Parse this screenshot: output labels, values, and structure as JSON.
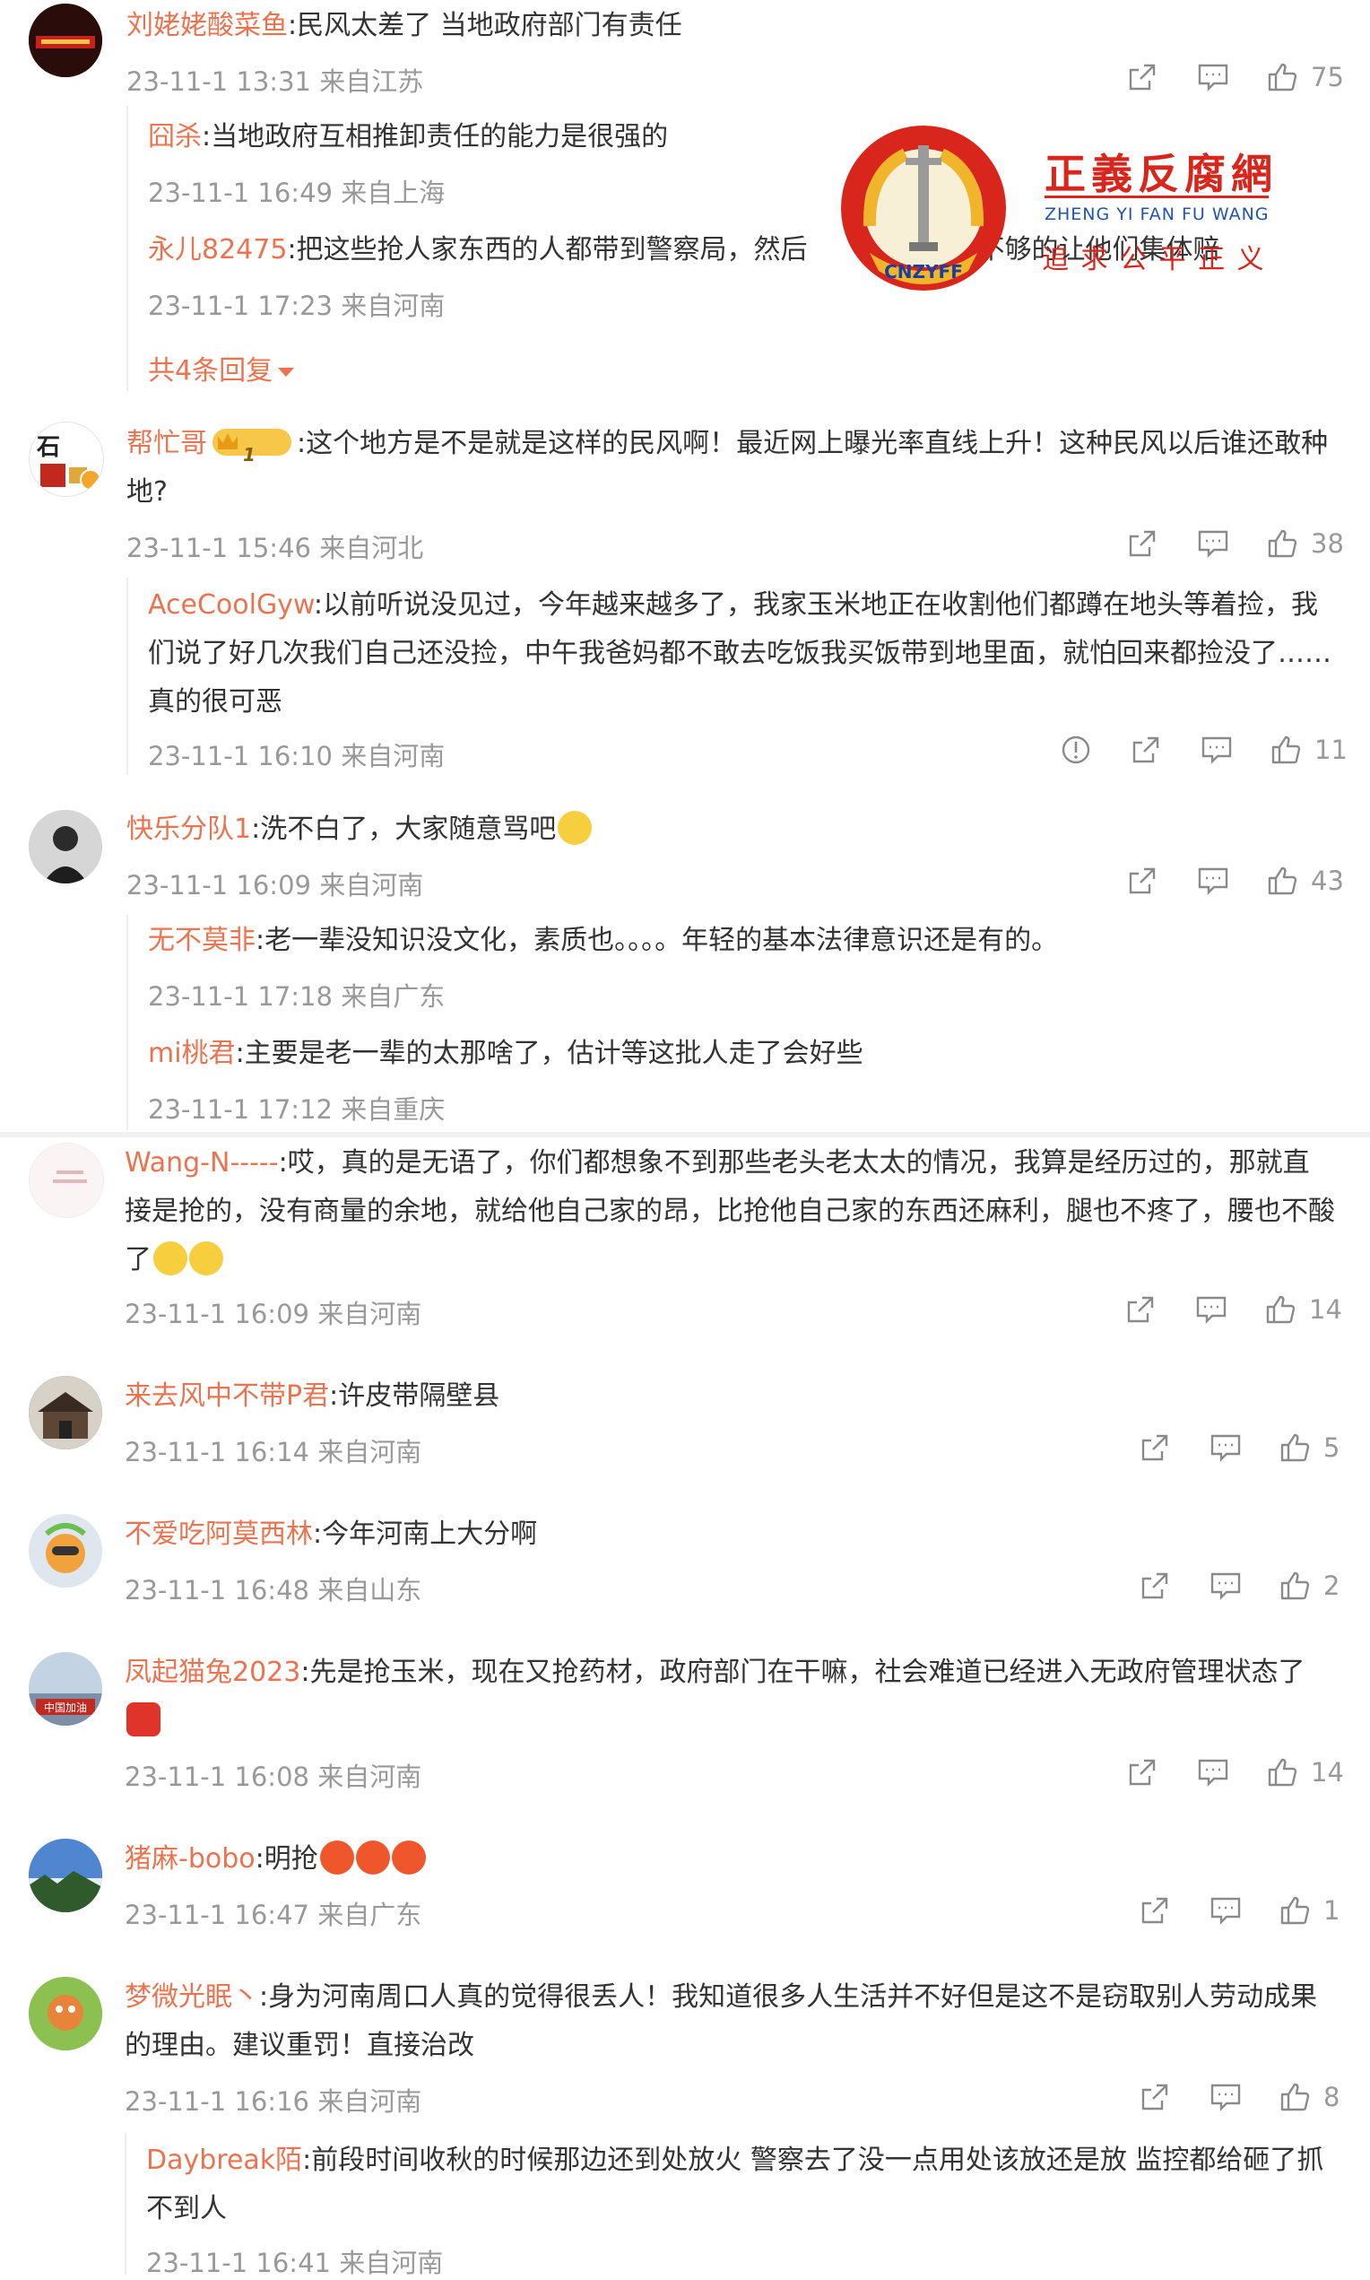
{
  "comments": [
    {
      "user": "刘姥姥酸菜鱼",
      "text": ":民风太差了 当地政府部门有责任",
      "meta": "23-11-1 13:31 来自江苏",
      "likes": "75",
      "avatar_color": "#b3201c",
      "replies": [
        {
          "user": "囧杀",
          "text": ":当地政府互相推卸责任的能力是很强的",
          "meta": "23-11-1 16:49 来自上海"
        },
        {
          "user": "永儿82475",
          "text": ":把这些抢人家东西的人都带到警察局，然后",
          "text_tail": "不够的让他们集体赔",
          "meta": "23-11-1 17:23 来自河南"
        }
      ],
      "more_replies": "共4条回复"
    },
    {
      "user": "帮忙哥",
      "badge_level": "1",
      "text": ":这个地方是不是就是这样的民风啊！最近网上曝光率直线上升！这种民风以后谁还敢种地?",
      "meta": "23-11-1 15:46 来自河北",
      "likes": "38",
      "replies": [
        {
          "user": "AceCoolGyw",
          "text": ":以前听说没见过，今年越来越多了，我家玉米地正在收割他们都蹲在地头等着捡，我们说了好几次我们自己还没捡，中午我爸妈都不敢去吃饭我买饭带到地里面，就怕回来都捡没了……真的很可恶",
          "meta": "23-11-1 16:10 来自河南",
          "likes": "11"
        }
      ]
    },
    {
      "user": "快乐分队1",
      "text": ":洗不白了，大家随意骂吧",
      "meta": "23-11-1 16:09 来自河南",
      "likes": "43",
      "replies": [
        {
          "user": "无不莫非",
          "text": ":老一辈没知识没文化，素质也。。。。年轻的基本法律意识还是有的。",
          "meta": "23-11-1 17:18 来自广东"
        },
        {
          "user": "mi桃君",
          "text": ":主要是老一辈的太那啥了，估计等这批人走了会好些",
          "meta": "23-11-1 17:12 来自重庆"
        }
      ]
    },
    {
      "user": "Wang-N-----",
      "text": ":哎，真的是无语了，你们都想象不到那些老头老太太的情况，我算是经历过的，那就直接是抢的，没有商量的余地，就给他自己家的昂，比抢他自己家的东西还麻利，腿也不疼了，腰也不酸了",
      "meta": "23-11-1 16:09 来自河南",
      "likes": "14"
    },
    {
      "user": "来去风中不带P君",
      "text": ":许皮带隔壁县",
      "meta": "23-11-1 16:14 来自河南",
      "likes": "5"
    },
    {
      "user": "不爱吃阿莫西林",
      "text": ":今年河南上大分啊",
      "meta": "23-11-1 16:48 来自山东",
      "likes": "2"
    },
    {
      "user": "凤起猫兔2023",
      "text": ":先是抢玉米，现在又抢药材，政府部门在干嘛，社会难道已经进入无政府管理状态了",
      "avatar_text": "中国加油",
      "meta": "23-11-1 16:08 来自河南",
      "likes": "14"
    },
    {
      "user": "猪麻-bobo",
      "text": ":明抢",
      "meta": "23-11-1 16:47 来自广东",
      "likes": "1"
    },
    {
      "user": "梦微光眠丶",
      "text": ":身为河南周口人真的觉得很丢人！我知道很多人生活并不好但是这不是窃取别人劳动成果的理由。建议重罚！直接治改",
      "meta": "23-11-1 16:16 来自河南",
      "likes": "8",
      "replies": [
        {
          "user": "Daybreak陌",
          "text": ":前段时间收秋的时候那边还到处放火 警察去了没一点用处该放还是放 监控都给砸了抓不到人",
          "meta": "23-11-1 16:41 来自河南"
        }
      ]
    }
  ],
  "watermark": {
    "title": "正義反腐網",
    "pinyin": "ZHENG YI FAN FU WANG",
    "slogan": "追 求 公 平 正 义",
    "seal_text": "CNZYFF"
  },
  "colors": {
    "name": "#eb7350",
    "text": "#333333",
    "meta": "#999999",
    "icon": "#8a8a8a"
  }
}
